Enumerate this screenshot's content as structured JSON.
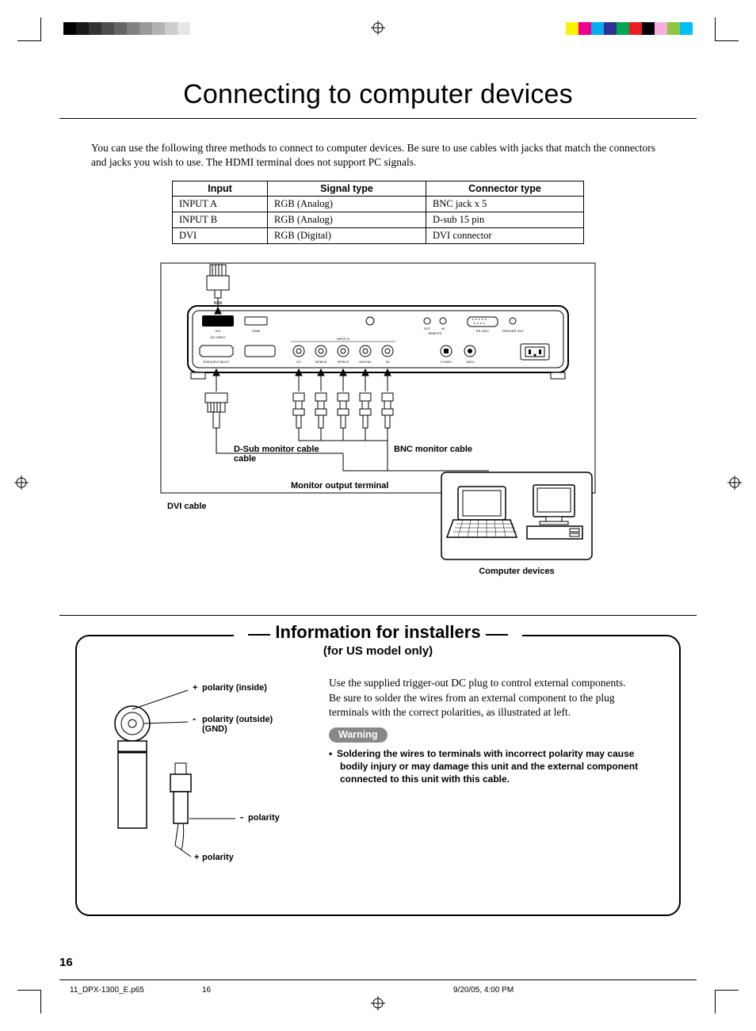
{
  "title": "Connecting to computer devices",
  "intro": "You can use the following three methods to connect to computer devices. Be sure to use cables with jacks that match the connectors and jacks you wish to use. The HDMI terminal does not support PC signals.",
  "table": {
    "headers": [
      "Input",
      "Signal type",
      "Connector type"
    ],
    "rows": [
      [
        "INPUT A",
        "RGB (Analog)",
        "BNC jack x 5"
      ],
      [
        "INPUT B",
        "RGB (Analog)",
        "D-sub 15 pin"
      ],
      [
        "DVI",
        "RGB (Digital)",
        "DVI connector"
      ]
    ]
  },
  "diagram": {
    "dvi_cable": "DVI cable",
    "dsub_cable": "D-Sub monitor cable",
    "bnc_cable": "BNC monitor cable",
    "monitor_out": "Monitor output terminal",
    "computer_devices": "Computer devices",
    "ports": {
      "dvi": "DVI",
      "hdmi": "HDMI",
      "d4video": "D4 VIDEO",
      "rgb_inputb": "RGB (INPUT B)/OUT",
      "input_a": "INPUT A",
      "gy": "G/Y",
      "bpbcb": "B/PB/CB",
      "rprcr": "R/PR/CR",
      "hsync": "HD/SYNC",
      "vd": "VD",
      "out": "OUT",
      "in": "IN",
      "remote": "REMOTE",
      "rs232c": "RS-232C",
      "trigger": "TRIGGER OUT",
      "svideo": "S VIDEO",
      "video": "VIDEO"
    }
  },
  "installers": {
    "heading": "Information for installers",
    "sub": "(for US model only)",
    "plus_inside": "polarity (inside)",
    "minus_outside": "polarity (outside) (GND)",
    "minus": "polarity",
    "plus": "polarity",
    "para1": "Use the supplied trigger-out DC plug to control external components.",
    "para2": "Be sure to solder the wires from an external component to the plug terminals with the correct polarities, as illustrated at left.",
    "warning_label": "Warning",
    "warning_text": "Soldering the wires to terminals with incorrect polarity may cause bodily injury or may damage this unit and the external component connected to this unit with this cable."
  },
  "page_number": "16",
  "footer": {
    "file": "11_DPX-1300_E.p65",
    "page": "16",
    "timestamp": "9/20/05, 4:00 PM"
  },
  "colors": {
    "grays": [
      "#000",
      "#1a1a1a",
      "#333",
      "#4d4d4d",
      "#666",
      "#808080",
      "#999",
      "#b3b3b3",
      "#ccc",
      "#e6e6e6"
    ],
    "hues": [
      "#fff200",
      "#ec008c",
      "#00aeef",
      "#2e3192",
      "#00a651",
      "#ed1c24",
      "#000000",
      "#f7adde",
      "#8dc63f",
      "#00bff3"
    ]
  }
}
